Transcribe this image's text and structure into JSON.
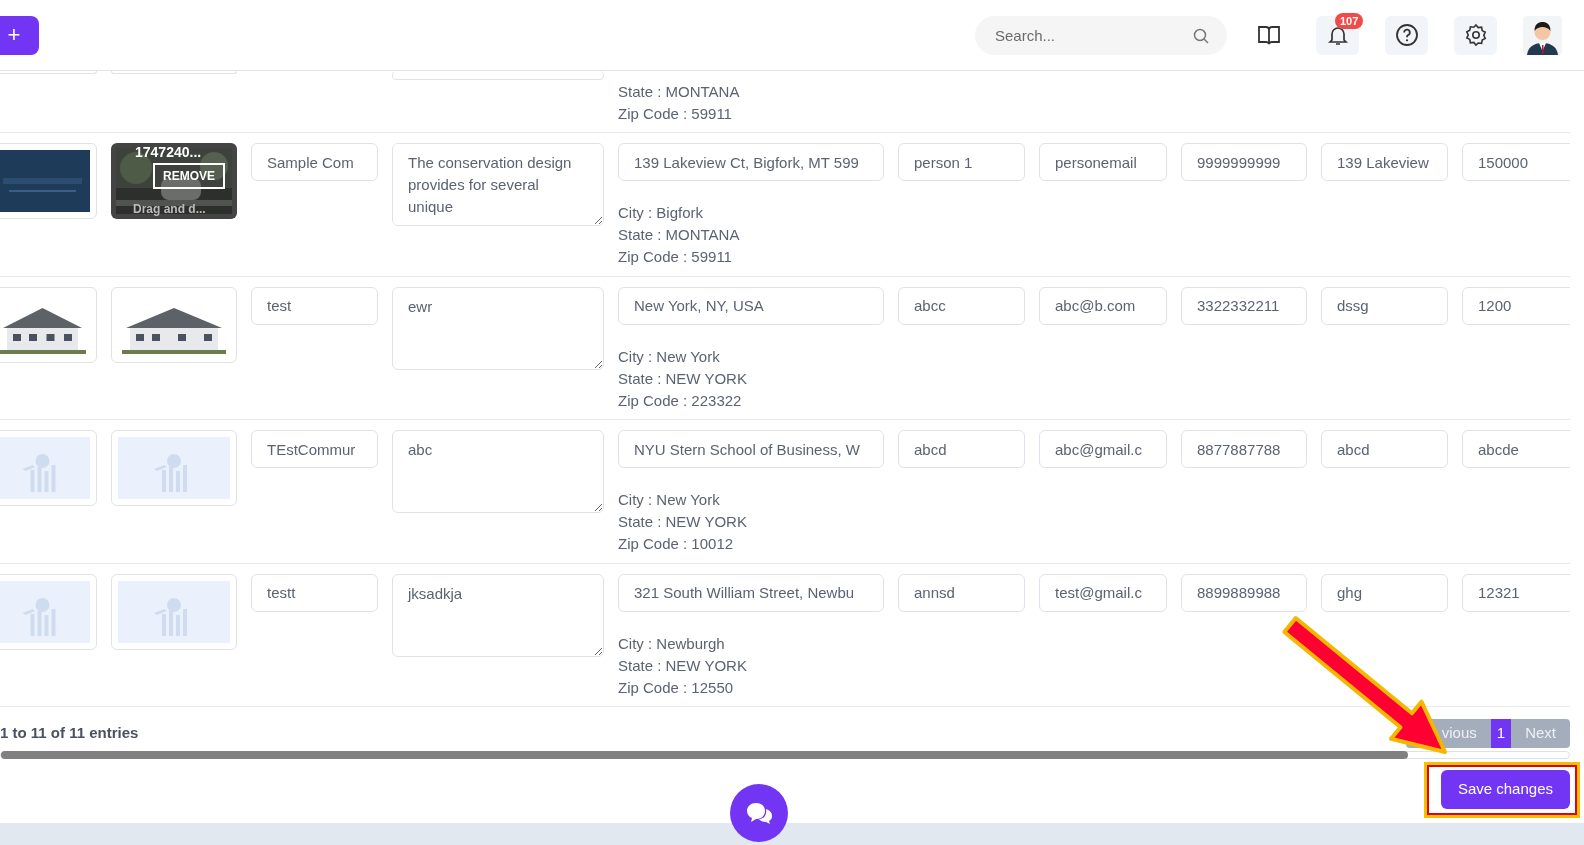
{
  "header": {
    "add_button": "+",
    "search": {
      "placeholder": "Search..."
    },
    "notification_count": "107"
  },
  "rows": [
    {
      "kind": "remnant",
      "address_details": [
        "State : MONTANA",
        "Zip Code : 59911"
      ]
    },
    {
      "kind": "full",
      "images": [
        {
          "kind": "logo"
        },
        {
          "kind": "upload",
          "file_name": "1747240...",
          "remove": "REMOVE",
          "hint": "Drag and d..."
        }
      ],
      "name": "Sample Com",
      "description": "The conservation design provides for several unique",
      "address": "139 Lakeview Ct, Bigfork, MT 599",
      "address_details": [
        "City : Bigfork",
        "State : MONTANA",
        "Zip Code : 59911"
      ],
      "fields": [
        "person 1",
        "personemail",
        "9999999999",
        "139 Lakeview",
        "150000"
      ]
    },
    {
      "kind": "full",
      "images": [
        {
          "kind": "house"
        },
        {
          "kind": "house"
        }
      ],
      "name": "test",
      "description": "ewr",
      "address": "New York, NY, USA",
      "address_details": [
        "City : New York",
        "State : NEW YORK",
        "Zip Code : 223322"
      ],
      "fields": [
        "abcc",
        "abc@b.com",
        "3322332211",
        "dssg",
        "1200"
      ]
    },
    {
      "kind": "full",
      "images": [
        {
          "kind": "placeholder"
        },
        {
          "kind": "placeholder"
        }
      ],
      "name": "TEstCommur",
      "description": "abc",
      "address": "NYU Stern School of Business, W",
      "address_details": [
        "City : New York",
        "State : NEW YORK",
        "Zip Code : 10012"
      ],
      "fields": [
        "abcd",
        "abc@gmail.c",
        "8877887788",
        "abcd",
        "abcde"
      ]
    },
    {
      "kind": "full",
      "images": [
        {
          "kind": "placeholder"
        },
        {
          "kind": "placeholder"
        }
      ],
      "name": "testt",
      "description": "jksadkja",
      "address": "321 South William Street, Newbu",
      "address_details": [
        "City : Newburgh",
        "State : NEW YORK",
        "Zip Code : 12550"
      ],
      "fields": [
        "annsd",
        "test@gmail.c",
        "8899889988",
        "ghg",
        "12321"
      ]
    }
  ],
  "footer": {
    "entries": "1 to 11 of 11 entries",
    "pagination": [
      {
        "label": "vious",
        "selected": false
      },
      {
        "label": "1",
        "selected": true
      },
      {
        "label": "Next",
        "selected": false
      }
    ],
    "save_button": "Save changes"
  }
}
